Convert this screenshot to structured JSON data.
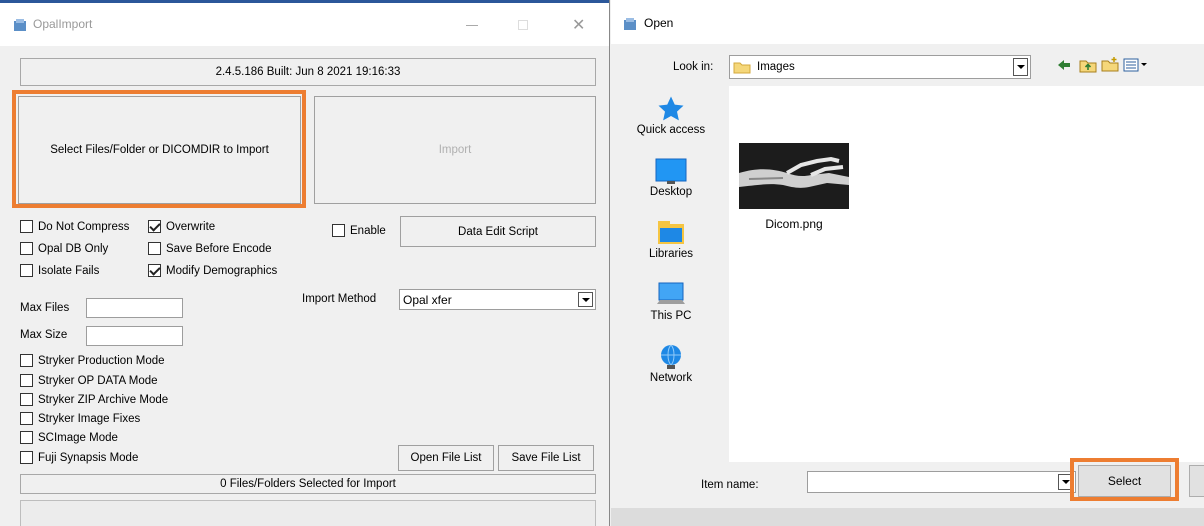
{
  "opal": {
    "title": "OpalImport",
    "version": "2.4.5.186  Built: Jun  8 2021 19:16:33",
    "select_button": "Select Files/Folder or DICOMDIR to Import",
    "import_button": "Import",
    "checks": {
      "do_not_compress": {
        "label": "Do Not Compress",
        "checked": false
      },
      "overwrite": {
        "label": "Overwrite",
        "checked": true
      },
      "opal_db_only": {
        "label": "Opal DB Only",
        "checked": false
      },
      "save_before_encode": {
        "label": "Save Before Encode",
        "checked": false
      },
      "isolate_fails": {
        "label": "Isolate Fails",
        "checked": false
      },
      "modify_demographics": {
        "label": "Modify Demographics",
        "checked": true
      },
      "enable": {
        "label": "Enable",
        "checked": false
      }
    },
    "data_edit_script": "Data Edit Script",
    "import_method_label": "Import Method",
    "import_method_value": "Opal xfer",
    "max_files_label": "Max Files",
    "max_size_label": "Max Size",
    "modes": [
      {
        "label": "Stryker Production Mode",
        "checked": false
      },
      {
        "label": "Stryker OP DATA Mode",
        "checked": false
      },
      {
        "label": "Stryker ZIP Archive Mode",
        "checked": false
      },
      {
        "label": "Stryker Image Fixes",
        "checked": false
      },
      {
        "label": "SCImage Mode",
        "checked": false
      },
      {
        "label": "Fuji Synapsis Mode",
        "checked": false
      }
    ],
    "open_file_list": "Open File List",
    "save_file_list": "Save File List",
    "status": "0 Files/Folders Selected for Import"
  },
  "open_dialog": {
    "title": "Open",
    "look_in_label": "Look in:",
    "look_in_value": "Images",
    "nav": [
      {
        "label": "Quick access",
        "icon": "quick-access-star-icon"
      },
      {
        "label": "Desktop",
        "icon": "desktop-icon"
      },
      {
        "label": "Libraries",
        "icon": "libraries-icon"
      },
      {
        "label": "This PC",
        "icon": "this-pc-icon"
      },
      {
        "label": "Network",
        "icon": "network-icon"
      }
    ],
    "file": {
      "name": "Dicom.png",
      "icon": "xray-thumbnail"
    },
    "item_name_label": "Item name:",
    "item_name_value": "",
    "select_button": "Select"
  },
  "colors": {
    "highlight": "#ed7d31",
    "star": "#1e88e5"
  }
}
